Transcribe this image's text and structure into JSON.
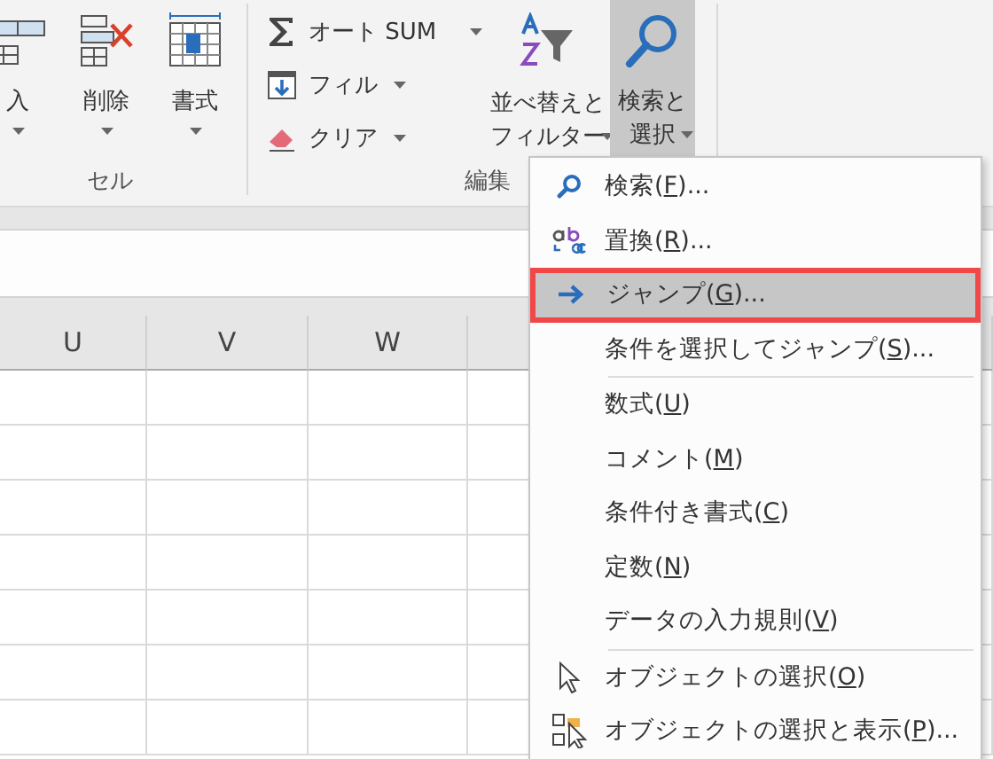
{
  "ribbon": {
    "groups": [
      {
        "label": "セル",
        "buttons": [
          {
            "kind": "insert",
            "lines": [
              "入"
            ],
            "dropdown": true,
            "pressed": false
          },
          {
            "kind": "delete",
            "lines": [
              "削除"
            ],
            "dropdown": true,
            "pressed": false
          },
          {
            "kind": "format",
            "lines": [
              "書式"
            ],
            "dropdown": true,
            "pressed": false
          }
        ]
      },
      {
        "label": "編集",
        "buttons": [
          {
            "kind": "autosum",
            "lines": [
              "オート SUM"
            ],
            "dropdown": true,
            "pressed": false
          },
          {
            "kind": "fill",
            "lines": [
              "フィル"
            ],
            "dropdown": true,
            "pressed": false
          },
          {
            "kind": "clear",
            "lines": [
              "クリア"
            ],
            "dropdown": true,
            "pressed": false
          },
          {
            "kind": "sort",
            "lines": [
              "並べ替えと",
              "フィルター"
            ],
            "dropdown": true,
            "pressed": false
          },
          {
            "kind": "find",
            "lines": [
              "検索と",
              "選択"
            ],
            "dropdown": true,
            "pressed": true
          }
        ]
      }
    ]
  },
  "sheet": {
    "columns": [
      "U",
      "V",
      "W"
    ]
  },
  "menu": {
    "items": [
      {
        "kind": "find",
        "before": "検索(",
        "key": "F",
        "after": ")...",
        "selected": false,
        "annotated": false
      },
      {
        "kind": "replace",
        "before": "置換(",
        "key": "R",
        "after": ")...",
        "selected": false,
        "annotated": false
      },
      {
        "kind": "goto",
        "before": "ジャンプ(",
        "key": "G",
        "after": ")...",
        "selected": true,
        "annotated": true
      },
      {
        "kind": "plain",
        "before": "条件を選択してジャンプ(",
        "key": "S",
        "after": ")...",
        "selected": false,
        "annotated": false
      },
      {
        "kind": "separator"
      },
      {
        "kind": "plain",
        "before": "数式(",
        "key": "U",
        "after": ")",
        "selected": false,
        "annotated": false
      },
      {
        "kind": "plain",
        "before": "コメント(",
        "key": "M",
        "after": ")",
        "selected": false,
        "annotated": false
      },
      {
        "kind": "plain",
        "before": "条件付き書式(",
        "key": "C",
        "after": ")",
        "selected": false,
        "annotated": false
      },
      {
        "kind": "plain",
        "before": "定数(",
        "key": "N",
        "after": ")",
        "selected": false,
        "annotated": false
      },
      {
        "kind": "plain",
        "before": "データの入力規則(",
        "key": "V",
        "after": ")",
        "selected": false,
        "annotated": false
      },
      {
        "kind": "separator"
      },
      {
        "kind": "pointer",
        "before": "オブジェクトの選択(",
        "key": "O",
        "after": ")",
        "selected": false,
        "annotated": false
      },
      {
        "kind": "pane",
        "before": "オブジェクトの選択と表示(",
        "key": "P",
        "after": ")...",
        "selected": false,
        "annotated": false
      }
    ]
  }
}
